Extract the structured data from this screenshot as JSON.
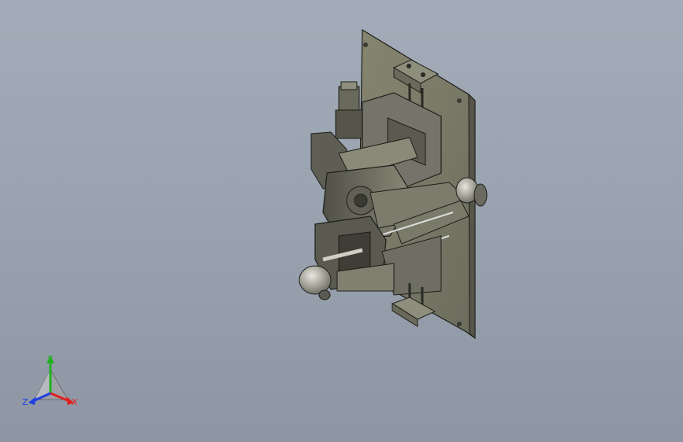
{
  "viewport": {
    "background_top": "#a3acb8",
    "background_bottom": "#8e96a4"
  },
  "model": {
    "icon": "cad-assembly-fixture",
    "base_plate_color": "#7c7c6c",
    "part_color": "#6f6f62",
    "edge_color": "#1e1e1a"
  },
  "triad": {
    "x_label": "X",
    "y_label": "Y",
    "z_label": "Z",
    "x_color": "#e02020",
    "y_color": "#20b020",
    "z_color": "#2040e0"
  }
}
